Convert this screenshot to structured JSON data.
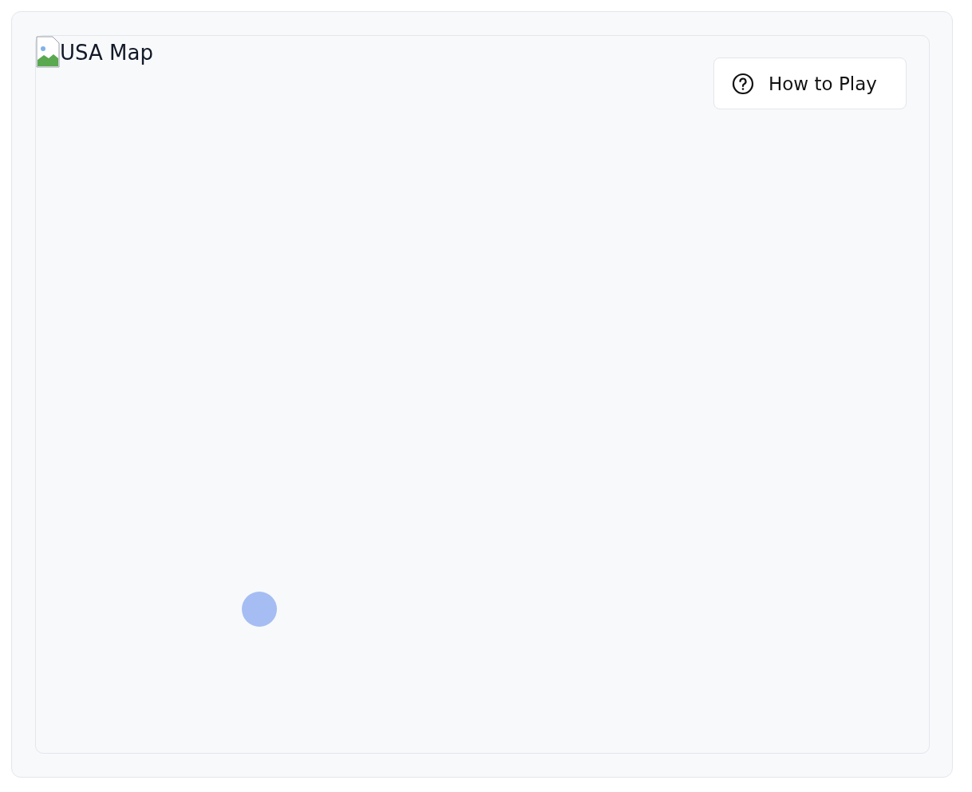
{
  "map": {
    "alt_text": "USA Map",
    "marker": {
      "kind": "dot"
    }
  },
  "help_button": {
    "label": "How to Play"
  }
}
